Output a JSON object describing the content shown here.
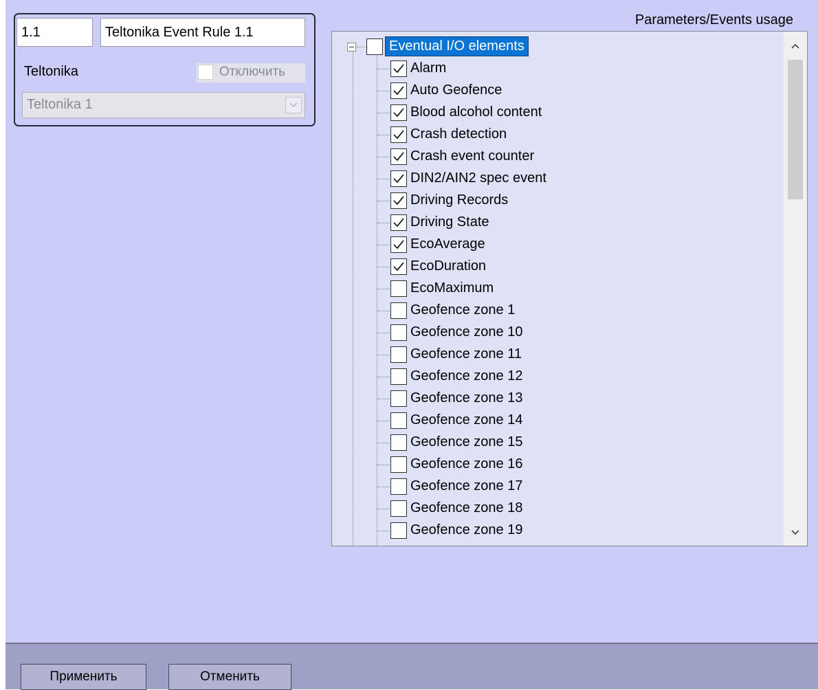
{
  "rule": {
    "id": "1.1",
    "name": "Teltonika Event Rule 1.1"
  },
  "device": {
    "label": "Teltonika",
    "disable_label": "Отключить",
    "disabled": false,
    "selected": "Teltonika 1"
  },
  "params": {
    "caption": "Parameters/Events usage",
    "root": {
      "label": "Eventual I/O elements",
      "checked": false,
      "expanded": true
    },
    "items": [
      {
        "label": "Alarm",
        "checked": true
      },
      {
        "label": "Auto Geofence",
        "checked": true
      },
      {
        "label": "Blood alcohol content",
        "checked": true
      },
      {
        "label": "Crash detection",
        "checked": true
      },
      {
        "label": "Crash event counter",
        "checked": true
      },
      {
        "label": "DIN2/AIN2 spec event",
        "checked": true
      },
      {
        "label": "Driving Records",
        "checked": true
      },
      {
        "label": "Driving State",
        "checked": true
      },
      {
        "label": "EcoAverage",
        "checked": true
      },
      {
        "label": "EcoDuration",
        "checked": true
      },
      {
        "label": "EcoMaximum",
        "checked": false
      },
      {
        "label": "Geofence zone 1",
        "checked": false
      },
      {
        "label": "Geofence zone 10",
        "checked": false
      },
      {
        "label": "Geofence zone 11",
        "checked": false
      },
      {
        "label": "Geofence zone 12",
        "checked": false
      },
      {
        "label": "Geofence zone 13",
        "checked": false
      },
      {
        "label": "Geofence zone 14",
        "checked": false
      },
      {
        "label": "Geofence zone 15",
        "checked": false
      },
      {
        "label": "Geofence zone 16",
        "checked": false
      },
      {
        "label": "Geofence zone 17",
        "checked": false
      },
      {
        "label": "Geofence zone 18",
        "checked": false
      },
      {
        "label": "Geofence zone 19",
        "checked": false
      }
    ]
  },
  "buttons": {
    "apply": "Применить",
    "cancel": "Отменить"
  },
  "icons": {
    "expander": "collapse-icon",
    "scroll_up": "chevron-up-icon",
    "scroll_down": "chevron-down-icon",
    "dropdown": "dropdown-arrow-icon"
  }
}
